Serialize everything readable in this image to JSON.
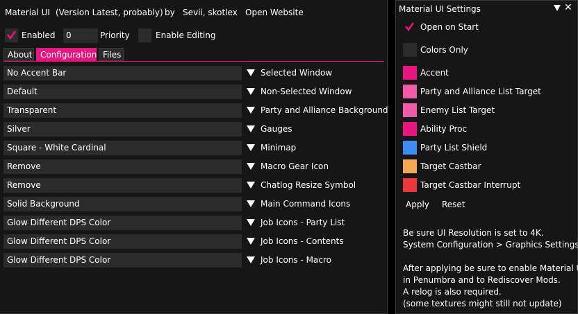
{
  "header": {
    "title": "Material UI",
    "version": "(Version Latest, probably)",
    "by": "by",
    "authors": "Sevii, skotlex",
    "open_website": "Open Website"
  },
  "controls": {
    "enabled_label": "Enabled",
    "enabled_checked": true,
    "priority_value": "0",
    "priority_label": "Priority",
    "enable_editing_label": "Enable Editing",
    "enable_editing_checked": false
  },
  "tabs": [
    {
      "label": "About",
      "active": false
    },
    {
      "label": "Configuration",
      "active": true
    },
    {
      "label": "Files",
      "active": false
    }
  ],
  "config": [
    {
      "value": "No Accent Bar",
      "label": "Selected Window"
    },
    {
      "value": "Default",
      "label": "Non-Selected Window"
    },
    {
      "value": "Transparent",
      "label": "Party and Alliance Background"
    },
    {
      "value": "Silver",
      "label": "Gauges"
    },
    {
      "value": "Square - White Cardinal",
      "label": "Minimap"
    },
    {
      "value": "Remove",
      "label": "Macro Gear Icon"
    },
    {
      "value": "Remove",
      "label": "Chatlog Resize Symbol"
    },
    {
      "value": "Solid Background",
      "label": "Main Command Icons"
    },
    {
      "value": "Glow Different DPS Color",
      "label": "Job Icons - Party List"
    },
    {
      "value": "Glow Different DPS Color",
      "label": "Job Icons - Contents"
    },
    {
      "value": "Glow Different DPS Color",
      "label": "Job Icons - Macro"
    }
  ],
  "settings": {
    "title": "Material UI Settings",
    "close_glyph": "✕",
    "open_on_start_label": "Open on Start",
    "open_on_start_checked": true,
    "colors_only_label": "Colors Only",
    "colors_only_checked": false,
    "colors": [
      {
        "label": "Accent",
        "color": "#e6157f"
      },
      {
        "label": "Party and Alliance List Target",
        "color": "#f25aaa"
      },
      {
        "label": "Enemy List Target",
        "color": "#f25aaa"
      },
      {
        "label": "Ability Proc",
        "color": "#e6157f"
      },
      {
        "label": "Party List Shield",
        "color": "#3d8bf5"
      },
      {
        "label": "Target Castbar",
        "color": "#f7a856"
      },
      {
        "label": "Target Castbar Interrupt",
        "color": "#e83a3a"
      }
    ],
    "apply_label": "Apply",
    "reset_label": "Reset",
    "info_lines": [
      "Be sure UI Resolution is set to 4K.",
      "System Configuration > Graphics Settings.",
      "",
      "After applying be sure to enable Material UI",
      "in Penumbra and to Rediscover Mods.",
      "A relog is also required.",
      "(some textures might still not update)"
    ]
  },
  "colors": {
    "accent": "#e6157f",
    "window_bg": "#161616",
    "control_bg": "#2b2b2b"
  }
}
